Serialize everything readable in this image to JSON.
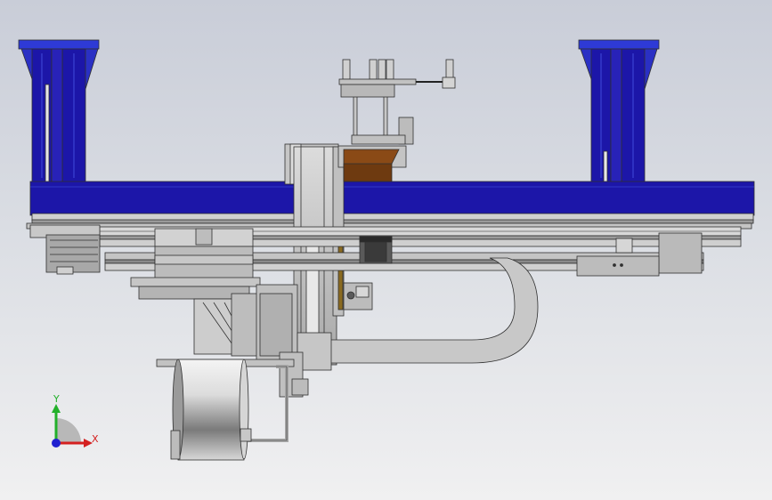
{
  "viewport": {
    "background_top": "#c9cdd8",
    "background_bottom": "#f0f0f1"
  },
  "colors": {
    "frame_blue": "#1c16a8",
    "frame_blue_light": "#2e3ad6",
    "steel_light": "#c8c8c8",
    "steel_mid": "#a4a4a4",
    "steel_dark": "#5a5a5a",
    "bronze": "#8a4a16",
    "outline": "#303030"
  },
  "triad": {
    "y_label": "Y",
    "x_label": "X",
    "y_color": "#22b02a",
    "x_color": "#d42020",
    "z_color": "#2020d0"
  }
}
